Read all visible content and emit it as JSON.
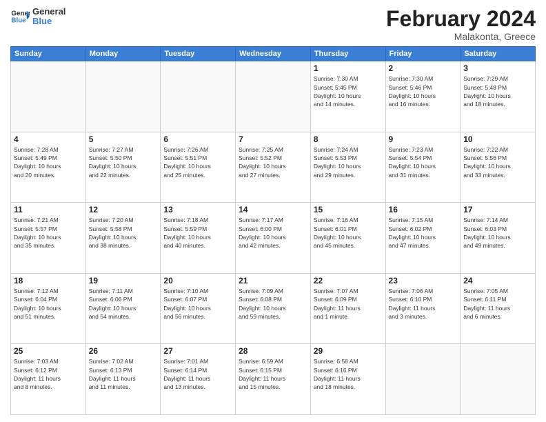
{
  "logo": {
    "general": "General",
    "blue": "Blue"
  },
  "header": {
    "title": "February 2024",
    "subtitle": "Malakonta, Greece"
  },
  "weekdays": [
    "Sunday",
    "Monday",
    "Tuesday",
    "Wednesday",
    "Thursday",
    "Friday",
    "Saturday"
  ],
  "weeks": [
    [
      {
        "day": "",
        "info": ""
      },
      {
        "day": "",
        "info": ""
      },
      {
        "day": "",
        "info": ""
      },
      {
        "day": "",
        "info": ""
      },
      {
        "day": "1",
        "info": "Sunrise: 7:30 AM\nSunset: 5:45 PM\nDaylight: 10 hours\nand 14 minutes."
      },
      {
        "day": "2",
        "info": "Sunrise: 7:30 AM\nSunset: 5:46 PM\nDaylight: 10 hours\nand 16 minutes."
      },
      {
        "day": "3",
        "info": "Sunrise: 7:29 AM\nSunset: 5:48 PM\nDaylight: 10 hours\nand 18 minutes."
      }
    ],
    [
      {
        "day": "4",
        "info": "Sunrise: 7:28 AM\nSunset: 5:49 PM\nDaylight: 10 hours\nand 20 minutes."
      },
      {
        "day": "5",
        "info": "Sunrise: 7:27 AM\nSunset: 5:50 PM\nDaylight: 10 hours\nand 22 minutes."
      },
      {
        "day": "6",
        "info": "Sunrise: 7:26 AM\nSunset: 5:51 PM\nDaylight: 10 hours\nand 25 minutes."
      },
      {
        "day": "7",
        "info": "Sunrise: 7:25 AM\nSunset: 5:52 PM\nDaylight: 10 hours\nand 27 minutes."
      },
      {
        "day": "8",
        "info": "Sunrise: 7:24 AM\nSunset: 5:53 PM\nDaylight: 10 hours\nand 29 minutes."
      },
      {
        "day": "9",
        "info": "Sunrise: 7:23 AM\nSunset: 5:54 PM\nDaylight: 10 hours\nand 31 minutes."
      },
      {
        "day": "10",
        "info": "Sunrise: 7:22 AM\nSunset: 5:56 PM\nDaylight: 10 hours\nand 33 minutes."
      }
    ],
    [
      {
        "day": "11",
        "info": "Sunrise: 7:21 AM\nSunset: 5:57 PM\nDaylight: 10 hours\nand 35 minutes."
      },
      {
        "day": "12",
        "info": "Sunrise: 7:20 AM\nSunset: 5:58 PM\nDaylight: 10 hours\nand 38 minutes."
      },
      {
        "day": "13",
        "info": "Sunrise: 7:18 AM\nSunset: 5:59 PM\nDaylight: 10 hours\nand 40 minutes."
      },
      {
        "day": "14",
        "info": "Sunrise: 7:17 AM\nSunset: 6:00 PM\nDaylight: 10 hours\nand 42 minutes."
      },
      {
        "day": "15",
        "info": "Sunrise: 7:16 AM\nSunset: 6:01 PM\nDaylight: 10 hours\nand 45 minutes."
      },
      {
        "day": "16",
        "info": "Sunrise: 7:15 AM\nSunset: 6:02 PM\nDaylight: 10 hours\nand 47 minutes."
      },
      {
        "day": "17",
        "info": "Sunrise: 7:14 AM\nSunset: 6:03 PM\nDaylight: 10 hours\nand 49 minutes."
      }
    ],
    [
      {
        "day": "18",
        "info": "Sunrise: 7:12 AM\nSunset: 6:04 PM\nDaylight: 10 hours\nand 51 minutes."
      },
      {
        "day": "19",
        "info": "Sunrise: 7:11 AM\nSunset: 6:06 PM\nDaylight: 10 hours\nand 54 minutes."
      },
      {
        "day": "20",
        "info": "Sunrise: 7:10 AM\nSunset: 6:07 PM\nDaylight: 10 hours\nand 56 minutes."
      },
      {
        "day": "21",
        "info": "Sunrise: 7:09 AM\nSunset: 6:08 PM\nDaylight: 10 hours\nand 59 minutes."
      },
      {
        "day": "22",
        "info": "Sunrise: 7:07 AM\nSunset: 6:09 PM\nDaylight: 11 hours\nand 1 minute."
      },
      {
        "day": "23",
        "info": "Sunrise: 7:06 AM\nSunset: 6:10 PM\nDaylight: 11 hours\nand 3 minutes."
      },
      {
        "day": "24",
        "info": "Sunrise: 7:05 AM\nSunset: 6:11 PM\nDaylight: 11 hours\nand 6 minutes."
      }
    ],
    [
      {
        "day": "25",
        "info": "Sunrise: 7:03 AM\nSunset: 6:12 PM\nDaylight: 11 hours\nand 8 minutes."
      },
      {
        "day": "26",
        "info": "Sunrise: 7:02 AM\nSunset: 6:13 PM\nDaylight: 11 hours\nand 11 minutes."
      },
      {
        "day": "27",
        "info": "Sunrise: 7:01 AM\nSunset: 6:14 PM\nDaylight: 11 hours\nand 13 minutes."
      },
      {
        "day": "28",
        "info": "Sunrise: 6:59 AM\nSunset: 6:15 PM\nDaylight: 11 hours\nand 15 minutes."
      },
      {
        "day": "29",
        "info": "Sunrise: 6:58 AM\nSunset: 6:16 PM\nDaylight: 11 hours\nand 18 minutes."
      },
      {
        "day": "",
        "info": ""
      },
      {
        "day": "",
        "info": ""
      }
    ]
  ]
}
